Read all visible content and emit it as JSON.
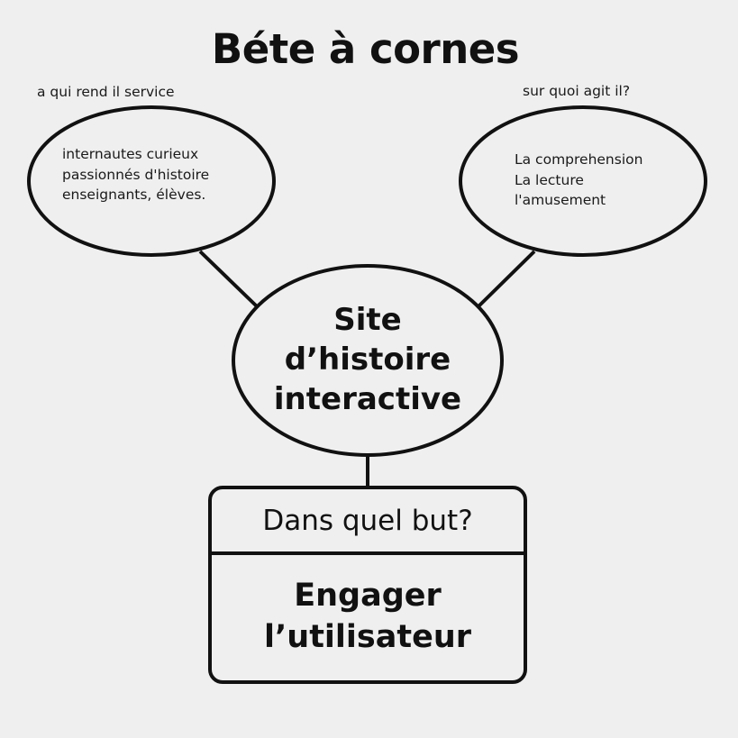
{
  "title": "Béte à cornes",
  "left": {
    "caption": "a qui rend il service",
    "lines": [
      "internautes curieux",
      "passionnés d'histoire",
      "enseignants, élèves."
    ]
  },
  "right": {
    "caption": "sur quoi agit il?",
    "lines": [
      "La comprehension",
      "La lecture",
      "l'amusement"
    ]
  },
  "center": {
    "lines": [
      "Site",
      "d’histoire",
      "interactive"
    ]
  },
  "goal": {
    "question": "Dans quel but?",
    "lines": [
      "Engager",
      "l’utilisateur"
    ]
  }
}
